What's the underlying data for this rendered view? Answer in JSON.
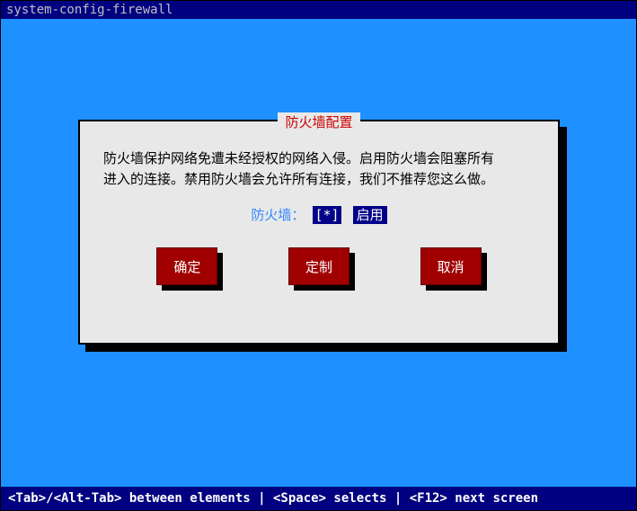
{
  "title_bar": "system-config-firewall",
  "dialog": {
    "title": "防火墙配置",
    "body_line1": "防火墙保护网络免遭未经授权的网络入侵。启用防火墙会阻塞所有",
    "body_line2": "进入的连接。禁用防火墙会允许所有连接，我们不推荐您这么做。",
    "checkbox_label": "防火墙：",
    "checkbox_state": "[*]",
    "checkbox_text": "启用",
    "buttons": {
      "ok": "确定",
      "customize": "定制",
      "cancel": "取消"
    }
  },
  "footer": "<Tab>/<Alt-Tab> between elements   |   <Space> selects   |  <F12> next screen"
}
